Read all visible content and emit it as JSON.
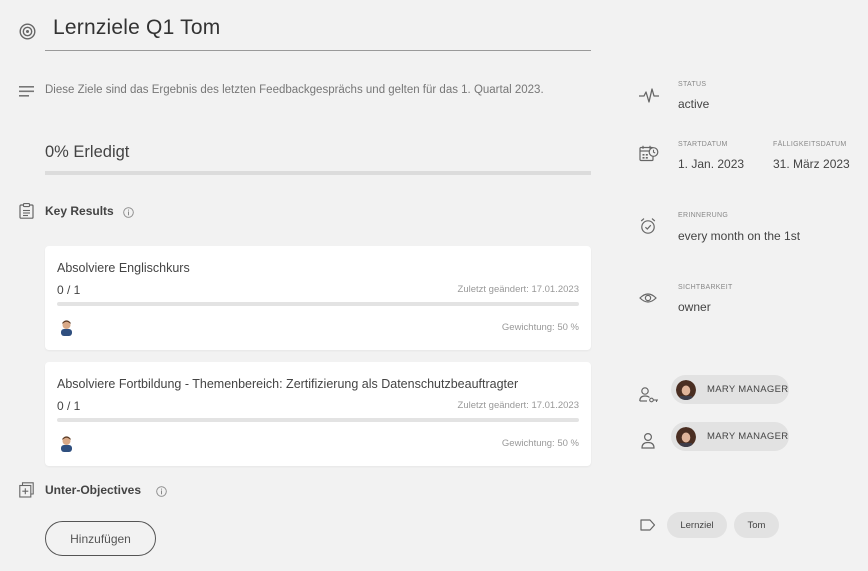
{
  "header": {
    "title": "Lernziele Q1 Tom",
    "description": "Diese Ziele sind das Ergebnis des letzten Feedbackgesprächs und gelten für das 1. Quartal 2023.",
    "progress_label": "0% Erledigt",
    "progress_fraction": 0.0
  },
  "key_results": {
    "title": "Key Results",
    "items": [
      {
        "title": "Absolviere Englischkurs",
        "progress": "0 / 1",
        "progress_fraction": 0.0,
        "changed": "Zuletzt geändert: 17.01.2023",
        "weight": "Gewichtung: 50 %"
      },
      {
        "title": "Absolviere Fortbildung - Themenbereich: Zertifizierung als Datenschutzbeauftragter",
        "progress": "0 / 1",
        "progress_fraction": 0.0,
        "changed": "Zuletzt geändert: 17.01.2023",
        "weight": "Gewichtung: 50 %"
      }
    ]
  },
  "sub_objectives": {
    "title": "Unter-Objectives",
    "add_button": "Hinzufügen"
  },
  "sidebar": {
    "status": {
      "label": "STATUS",
      "value": "active"
    },
    "start_date": {
      "label": "STARTDATUM",
      "value": "1. Jan. 2023"
    },
    "due_date": {
      "label": "FÄLLIGKEITSDATUM",
      "value": "31. März 2023"
    },
    "reminder": {
      "label": "ERINNERUNG",
      "value": "every month on the 1st"
    },
    "visibility": {
      "label": "SICHTBARKEIT",
      "value": "owner"
    },
    "manager_chip": "MARY MANAGER",
    "owner_chip": "MARY MANAGER",
    "tags": [
      "Lernziel",
      "Tom"
    ]
  },
  "colors": {
    "background": "#f2f2f2",
    "card": "#ffffff",
    "progress_accent": "#6b9bd1",
    "chip": "#e2e2e2"
  }
}
